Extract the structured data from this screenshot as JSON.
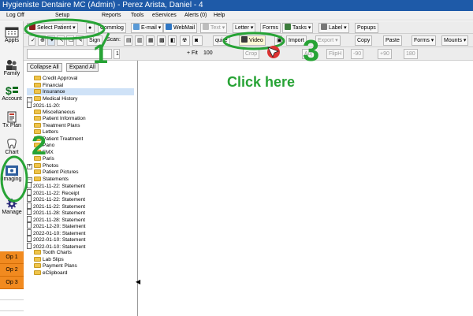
{
  "window": {
    "title": "Hygieniste Dentaire MC (Admin) - Perez Arista, Daniel - 4"
  },
  "menu": [
    "Log Off",
    "Setup",
    "Reports",
    "Tools",
    "eServices",
    "Alerts (0)",
    "Help"
  ],
  "toolbar_main": {
    "select_patient": "Select Patient",
    "commlog": "Commlog",
    "email": "E-mail",
    "webmail": "WebMail",
    "text": "Text",
    "letter": "Letter",
    "forms": "Forms",
    "tasks": "Tasks",
    "label": "Label",
    "popups": "Popups"
  },
  "toolbar_imaging": {
    "sign": "Sign",
    "scan": "Scan:",
    "acquire": "quire",
    "video": "Video",
    "import": "Import",
    "export": "Export",
    "copy": "Copy",
    "paste": "Paste",
    "forms": "Forms",
    "mounts": "Mounts"
  },
  "toolbar_view": {
    "fit": "Fit",
    "zoom": "100",
    "fliph": "FlipH",
    "rot_minus": "-90",
    "rot_plus": "+90",
    "rot_180": "180",
    "adj": "Adj",
    "crop": "Crop",
    "input_value": "1"
  },
  "leftbar": {
    "appts": "Appts",
    "family": "Family",
    "account": "Account",
    "txplan": "Tx Plan",
    "chart": "Chart",
    "imaging": "Imaging",
    "manage": "Manage",
    "ops": [
      "Op 1",
      "Op 2",
      "Op 3"
    ]
  },
  "tree": {
    "collapse": "Collapse All",
    "expand": "Expand All",
    "nodes": [
      {
        "label": "Credit Approval",
        "type": "folder",
        "indent": 0
      },
      {
        "label": "Financial",
        "type": "folder",
        "indent": 0
      },
      {
        "label": "Insurance",
        "type": "folder",
        "indent": 0,
        "selected": true
      },
      {
        "label": "Medical History",
        "type": "folder-open",
        "indent": 0
      },
      {
        "label": "2021-11-20:",
        "type": "doc",
        "indent": 1
      },
      {
        "label": "Miscellaneous",
        "type": "folder",
        "indent": 0
      },
      {
        "label": "Patient Information",
        "type": "folder",
        "indent": 0
      },
      {
        "label": "Treatment Plans",
        "type": "folder",
        "indent": 0
      },
      {
        "label": "Letters",
        "type": "folder",
        "indent": 0
      },
      {
        "label": "Patient Treatment",
        "type": "folder",
        "indent": 0
      },
      {
        "label": "Pano",
        "type": "folder",
        "indent": 0
      },
      {
        "label": "FMX",
        "type": "folder",
        "indent": 0
      },
      {
        "label": "Paris",
        "type": "folder",
        "indent": 0
      },
      {
        "label": "Photos",
        "type": "folder-expand",
        "indent": 0
      },
      {
        "label": "Patient Pictures",
        "type": "folder",
        "indent": 0
      },
      {
        "label": "Statements",
        "type": "folder-open",
        "indent": 0
      },
      {
        "label": "2021-11-22: Statement",
        "type": "doc",
        "indent": 1
      },
      {
        "label": "2021-11-22: Receipt",
        "type": "doc",
        "indent": 1
      },
      {
        "label": "2021-11-22: Statement",
        "type": "doc",
        "indent": 1
      },
      {
        "label": "2021-11-22: Statement",
        "type": "doc",
        "indent": 1
      },
      {
        "label": "2021-11-28: Statement",
        "type": "doc",
        "indent": 1
      },
      {
        "label": "2021-11-28: Statement",
        "type": "doc",
        "indent": 1
      },
      {
        "label": "2021-12-20: Statement",
        "type": "doc",
        "indent": 1
      },
      {
        "label": "2022-01-10: Statement",
        "type": "doc",
        "indent": 1
      },
      {
        "label": "2022-01-10: Statement",
        "type": "doc",
        "indent": 1
      },
      {
        "label": "2022-01-10: Statement",
        "type": "doc",
        "indent": 1
      },
      {
        "label": "Tooth Charts",
        "type": "folder",
        "indent": 0
      },
      {
        "label": "Lab Slips",
        "type": "folder",
        "indent": 0
      },
      {
        "label": "Payment Plans",
        "type": "folder",
        "indent": 0
      },
      {
        "label": "eClipboard",
        "type": "folder",
        "indent": 0
      }
    ]
  },
  "annotations": {
    "num1": "1",
    "num2": "2",
    "num3": "3",
    "click_here": "Click here",
    "color": "#27a335"
  }
}
